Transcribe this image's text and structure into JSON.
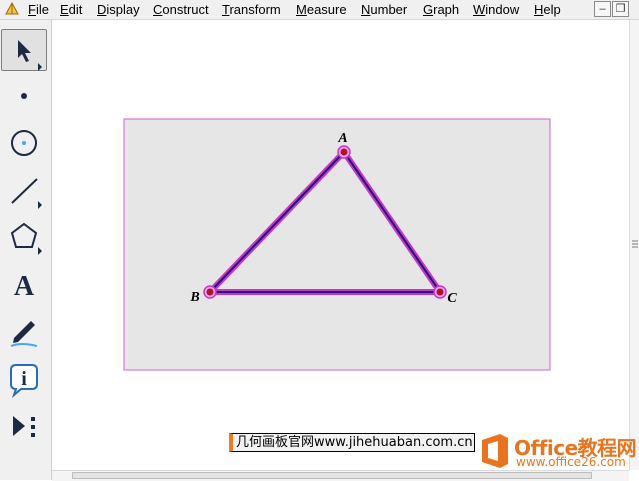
{
  "menubar": {
    "items": [
      {
        "label": "File",
        "accel": "F"
      },
      {
        "label": "Edit",
        "accel": "E"
      },
      {
        "label": "Display",
        "accel": "D"
      },
      {
        "label": "Construct",
        "accel": "C"
      },
      {
        "label": "Transform",
        "accel": "T"
      },
      {
        "label": "Measure",
        "accel": "M"
      },
      {
        "label": "Number",
        "accel": "N"
      },
      {
        "label": "Graph",
        "accel": "G"
      },
      {
        "label": "Window",
        "accel": "W"
      },
      {
        "label": "Help",
        "accel": "H"
      }
    ],
    "window_buttons": [
      "minimize-icon",
      "restore-icon",
      "close-icon"
    ]
  },
  "toolbar": {
    "tools": [
      {
        "name": "arrow-tool",
        "icon": "arrow-select-icon",
        "selected": true
      },
      {
        "name": "point-tool",
        "icon": "point-icon",
        "selected": false
      },
      {
        "name": "compass-tool",
        "icon": "circle-icon",
        "selected": false
      },
      {
        "name": "straightedge-tool",
        "icon": "segment-icon",
        "selected": false
      },
      {
        "name": "polygon-tool",
        "icon": "pentagon-icon",
        "selected": false
      },
      {
        "name": "text-tool",
        "icon": "text-A-icon",
        "selected": false
      },
      {
        "name": "marker-tool",
        "icon": "pen-icon",
        "selected": false
      },
      {
        "name": "information-tool",
        "icon": "info-icon",
        "selected": false
      },
      {
        "name": "custom-tool",
        "icon": "play-dots-icon",
        "selected": false
      }
    ]
  },
  "canvas": {
    "points": [
      {
        "label": "A"
      },
      {
        "label": "B"
      },
      {
        "label": "C"
      }
    ],
    "colors": {
      "segment": "#1a1a6e",
      "highlight": "#cc33cc",
      "point_fill": "#b0102a",
      "selection_rect_fill": "#e6e6e6",
      "selection_rect_border": "#cc66cc"
    }
  },
  "watermark": {
    "text": "几何画板官网www.jihehuaban.com.cn"
  },
  "logo": {
    "main": "Office教程网",
    "sub": "www.office26.com",
    "icon": "office-logo-icon",
    "color": "#e8741f"
  }
}
